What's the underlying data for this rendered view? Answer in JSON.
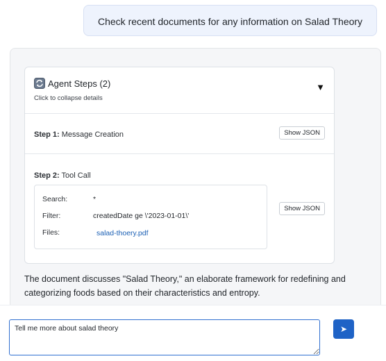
{
  "user_message": {
    "text": "Check recent documents for any information on Salad Theory"
  },
  "agent_steps": {
    "title": "Agent Steps (2)",
    "subtitle": "Click to collapse details",
    "toggle_icon": "▼",
    "icon": "refresh-icon",
    "steps": [
      {
        "number_label": "Step 1:",
        "name": "Message Creation",
        "json_button_label": "Show JSON"
      },
      {
        "number_label": "Step 2:",
        "name": "Tool Call",
        "json_button_label": "Show JSON",
        "details": {
          "search_key": "Search:",
          "search_value": "*",
          "filter_key": "Filter:",
          "filter_value": "createdDate ge \\'2023-01-01\\'",
          "files_key": "Files:",
          "files_value": "salad-thoery.pdf"
        }
      }
    ]
  },
  "assistant_response": {
    "text": "The document discusses \"Salad Theory,\" an elaborate framework for redefining and categorizing foods based on their characteristics and entropy."
  },
  "composer": {
    "input_value": "Tell me more about salad theory",
    "send_icon": "➤"
  },
  "colors": {
    "accent": "#1f63c6",
    "user_bubble": "#eef3fd",
    "panel_background": "#f5f6f8",
    "link": "#1a5fb4"
  }
}
